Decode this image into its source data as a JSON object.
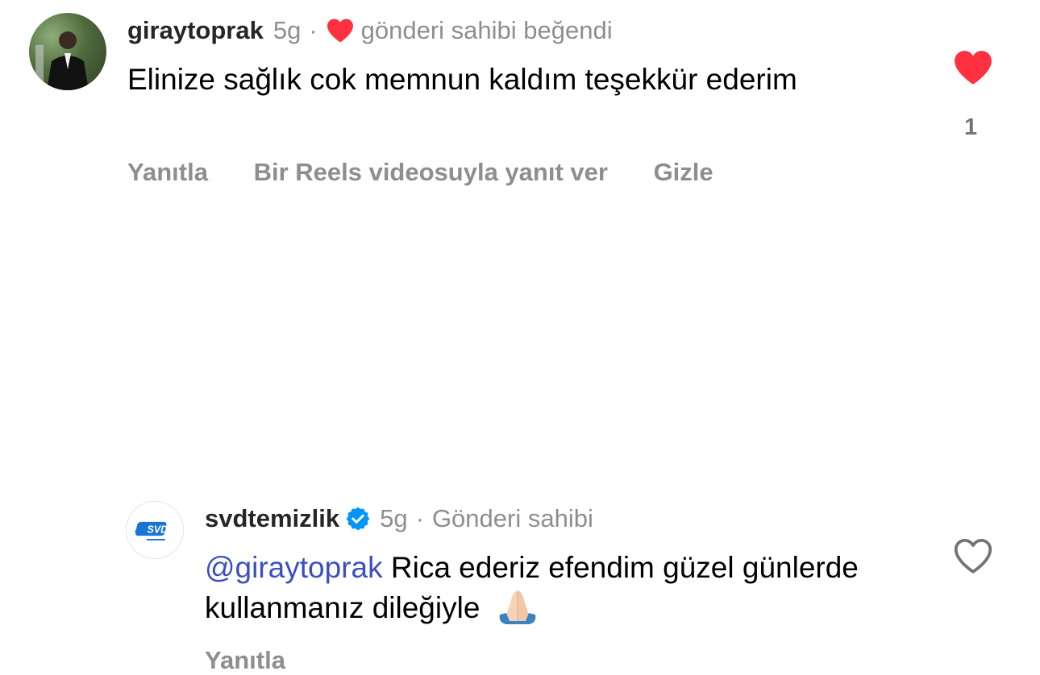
{
  "comment1": {
    "username": "giraytoprak",
    "time": "5g",
    "separator": "·",
    "liked_by_author": "gönderi sahibi beğendi",
    "text": "Elinize sağlık cok memnun kaldım teşekkür ederim",
    "actions": {
      "reply": "Yanıtla",
      "reels_reply": "Bir Reels videosuyla yanıt ver",
      "hide": "Gizle"
    },
    "like_count": "1",
    "liked": true,
    "heart_color": "#ff3040"
  },
  "comment2": {
    "username": "svdtemizlik",
    "verified": true,
    "time": "5g",
    "separator": "·",
    "author_badge": "Gönderi sahibi",
    "mention": "@giraytoprak",
    "text": "Rica ederiz efendim güzel günlerde kullanmanız dileğiyle",
    "actions": {
      "reply": "Yanıtla"
    },
    "liked": false,
    "mention_color": "#3c4fc2",
    "verified_color": "#0095f6"
  }
}
